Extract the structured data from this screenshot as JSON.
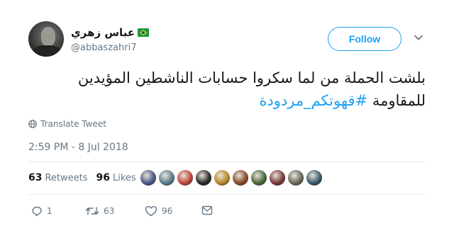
{
  "author": {
    "display_name": "عباس زهري",
    "handle": "@abbaszahri7",
    "flag_icon": "brazil-flag-icon"
  },
  "follow_label": "Follow",
  "tweet": {
    "text": "بلشت الحملة من لما سكروا حسابات الناشطين المؤيدين للمقاومة ",
    "hashtag": "#قهوتكم_مردودة"
  },
  "translate_label": "Translate Tweet",
  "timestamp": "2:59 PM - 8 Jul 2018",
  "stats": {
    "retweets_count": "63",
    "retweets_label": "Retweets",
    "likes_count": "96",
    "likes_label": "Likes"
  },
  "likers": [
    {
      "name": "liker-avatar-1",
      "color": "#4a5a8a"
    },
    {
      "name": "liker-avatar-2",
      "color": "#5b7d8c"
    },
    {
      "name": "liker-avatar-3",
      "color": "#c0463a"
    },
    {
      "name": "liker-avatar-4",
      "color": "#2a2a2a"
    },
    {
      "name": "liker-avatar-5",
      "color": "#b88a2a"
    },
    {
      "name": "liker-avatar-6",
      "color": "#8a4a2a"
    },
    {
      "name": "liker-avatar-7",
      "color": "#4a6a3a"
    },
    {
      "name": "liker-avatar-8",
      "color": "#7a3a3a"
    },
    {
      "name": "liker-avatar-9",
      "color": "#6a6a5a"
    },
    {
      "name": "liker-avatar-10",
      "color": "#3a5a6a"
    }
  ],
  "actions": {
    "reply_count": "1",
    "retweet_count": "63",
    "like_count": "96"
  },
  "colors": {
    "accent": "#1da1f2",
    "text": "#14171a",
    "muted": "#657786",
    "divider": "#e6ecf0"
  }
}
